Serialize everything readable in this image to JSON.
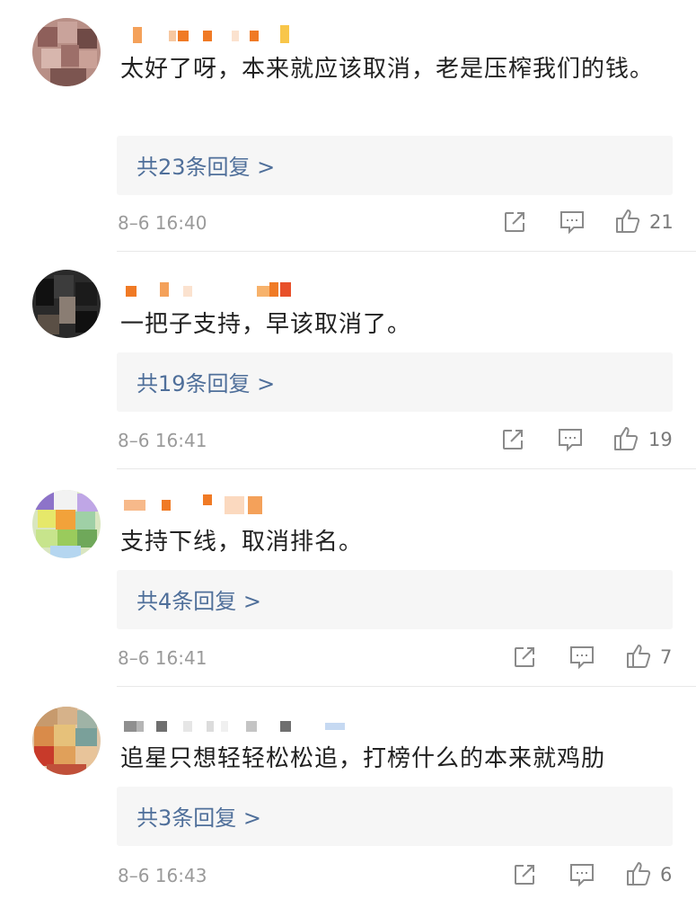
{
  "comments": [
    {
      "text": "太好了呀，本来就应该取消，老是压榨我们的钱。",
      "replies": "共23条回复 >",
      "time": "8–6 16:40",
      "likes": "21"
    },
    {
      "text": "一把子支持，早该取消了。",
      "replies": "共19条回复 >",
      "time": "8–6 16:41",
      "likes": "19"
    },
    {
      "text": "支持下线，取消排名。",
      "replies": "共4条回复 >",
      "time": "8–6 16:41",
      "likes": "7"
    },
    {
      "text": "追星只想轻轻松松追，打榜什么的本来就鸡肋",
      "replies": "共3条回复 >",
      "time": "8–6 16:43",
      "likes": "6"
    }
  ],
  "icons": {
    "share": "share-icon",
    "comment": "comment-icon",
    "like": "thumbs-up-icon"
  },
  "colors": {
    "link": "#4f6f9a",
    "meta": "#9a9a9a",
    "reply_bg": "#f6f6f6"
  }
}
